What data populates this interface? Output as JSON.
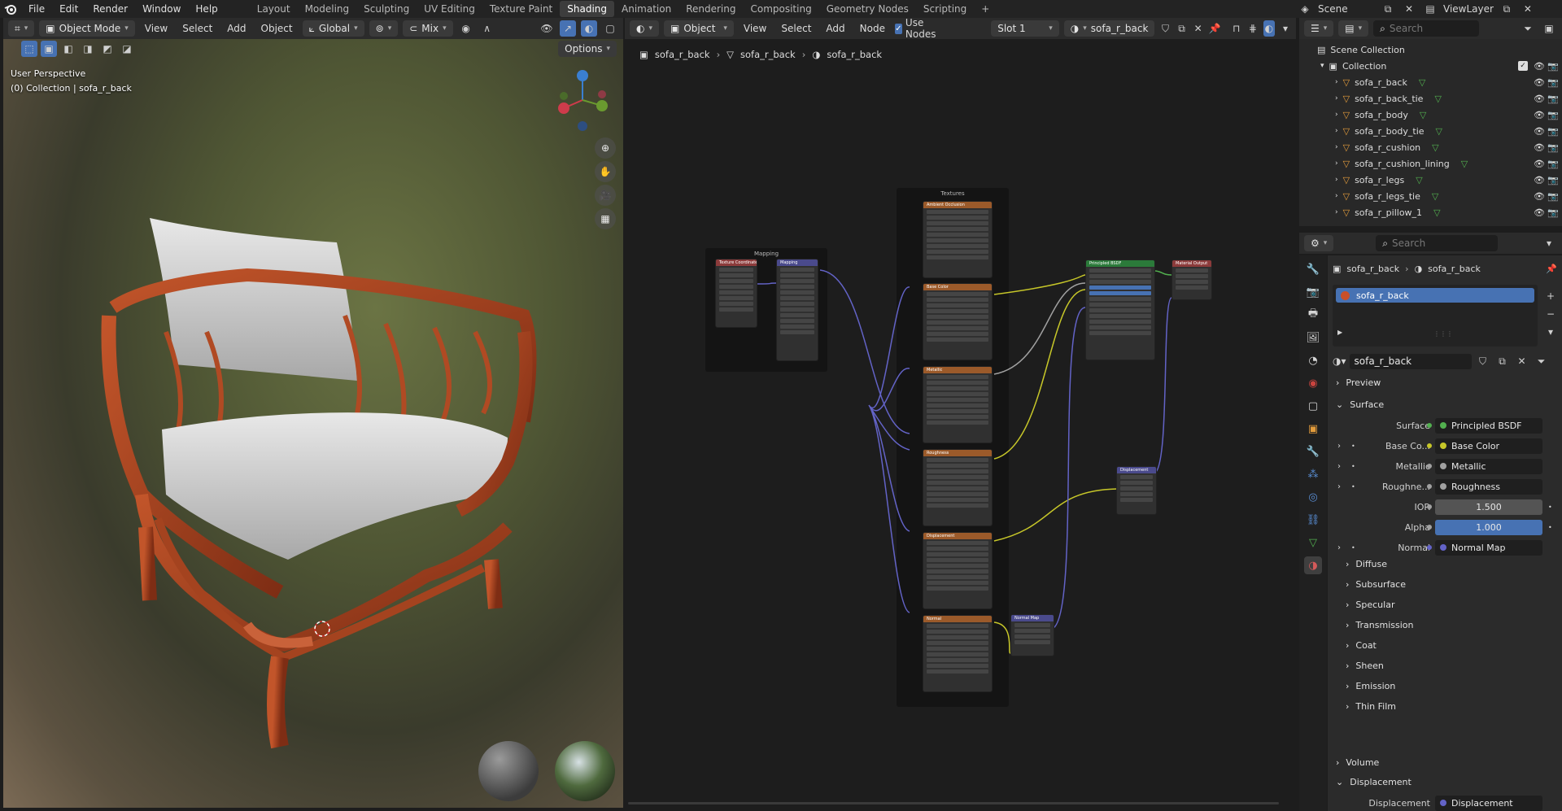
{
  "topbar": {
    "menus": [
      "File",
      "Edit",
      "Render",
      "Window",
      "Help"
    ],
    "workspaces": [
      "Layout",
      "Modeling",
      "Sculpting",
      "UV Editing",
      "Texture Paint",
      "Shading",
      "Animation",
      "Rendering",
      "Compositing",
      "Geometry Nodes",
      "Scripting"
    ],
    "active_workspace": "Shading",
    "add_tab": "+",
    "scene": "Scene",
    "view_layer": "ViewLayer"
  },
  "viewport": {
    "mode": "Object Mode",
    "menus": [
      "View",
      "Select",
      "Add",
      "Object"
    ],
    "orientation": "Global",
    "shading_mix": "Mix",
    "options": "Options",
    "overlay_line1": "User Perspective",
    "overlay_line2": "(0) Collection | sofa_r_back"
  },
  "node_editor": {
    "type": "Object",
    "menus": [
      "View",
      "Select",
      "Add",
      "Node"
    ],
    "use_nodes": "Use Nodes",
    "slot": "Slot 1",
    "material": "sofa_r_back",
    "breadcrumb": [
      "sofa_r_back",
      "sofa_r_back",
      "sofa_r_back"
    ],
    "frames": {
      "mapping": "Mapping",
      "textures": "Textures"
    },
    "nodes": {
      "tex_coord": "Texture Coordinate",
      "mapping": "Mapping",
      "base_color": "Base Color",
      "metallic": "Metallic",
      "roughness": "Roughness",
      "displacement_tex": "Displacement",
      "normal_tex": "Normal",
      "ambient_occlusion": "Ambient Occlusion",
      "bsdf": "Principled BSDF",
      "output": "Material Output",
      "displacement": "Displacement",
      "normal_map": "Normal Map"
    }
  },
  "outliner": {
    "search_placeholder": "Search",
    "scene_collection": "Scene Collection",
    "collection": "Collection",
    "items": [
      "sofa_r_back",
      "sofa_r_back_tie",
      "sofa_r_body",
      "sofa_r_body_tie",
      "sofa_r_cushion",
      "sofa_r_cushion_lining",
      "sofa_r_legs",
      "sofa_r_legs_tie",
      "sofa_r_pillow_1"
    ]
  },
  "properties": {
    "search_placeholder": "Search",
    "breadcrumb": [
      "sofa_r_back",
      "sofa_r_back"
    ],
    "slot_name": "sofa_r_back",
    "material_name": "sofa_r_back",
    "preview": "Preview",
    "surface": "Surface",
    "rows": [
      {
        "label": "Surface",
        "value": "Principled BSDF",
        "dot": "#52b04f",
        "style": "dark"
      },
      {
        "label": "Base Co...",
        "value": "Base Color",
        "dot": "#c7c729",
        "style": "dark",
        "expand": true
      },
      {
        "label": "Metallic",
        "value": "Metallic",
        "dot": "#a1a1a1",
        "style": "dark",
        "expand": true
      },
      {
        "label": "Roughne...",
        "value": "Roughness",
        "dot": "#a1a1a1",
        "style": "dark",
        "expand": true
      },
      {
        "label": "IOR",
        "value": "1.500",
        "dot": "#a1a1a1",
        "style": "num"
      },
      {
        "label": "Alpha",
        "value": "1.000",
        "dot": "#a1a1a1",
        "style": "blue"
      },
      {
        "label": "Normal",
        "value": "Normal Map",
        "dot": "#6363c7",
        "style": "dark",
        "expand": true
      }
    ],
    "subpanels": [
      "Diffuse",
      "Subsurface",
      "Specular",
      "Transmission",
      "Coat",
      "Sheen",
      "Emission",
      "Thin Film"
    ],
    "volume": "Volume",
    "displacement": "Displacement",
    "displacement_row": {
      "label": "Displacement",
      "value": "Displacement"
    }
  },
  "colors": {
    "accent": "#4772b3",
    "frame_bg": "#141414",
    "wire_yellow": "#c7c729",
    "wire_purple": "#6363c7",
    "wire_grey": "#a1a1a1",
    "wire_green": "#52b04f"
  }
}
